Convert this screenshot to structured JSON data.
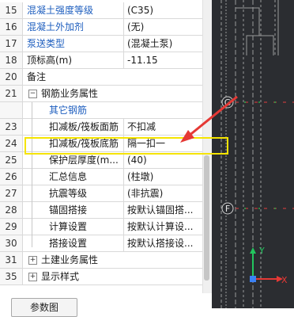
{
  "properties": {
    "rows": [
      {
        "num": "15",
        "name": "混凝土强度等级",
        "value": "(C35)",
        "blue": true
      },
      {
        "num": "16",
        "name": "混凝土外加剂",
        "value": "(无)",
        "blue": true
      },
      {
        "num": "17",
        "name": "泵送类型",
        "value": "(混凝土泵)",
        "blue": true
      },
      {
        "num": "18",
        "name": "顶标高(m)",
        "value": "-11.15",
        "blue": false
      },
      {
        "num": "20",
        "name": "备注",
        "value": "",
        "blue": false
      },
      {
        "num": "21",
        "name": "钢筋业务属性",
        "value": "",
        "blue": false,
        "toggle": "−"
      },
      {
        "num": "",
        "name": "其它钢筋",
        "value": "",
        "blue": true
      },
      {
        "num": "23",
        "name": "扣减板/筏板面筋",
        "value": "不扣减",
        "blue": false
      },
      {
        "num": "24",
        "name": "扣减板/筏板底筋",
        "value": "隔一扣一",
        "blue": false
      },
      {
        "num": "25",
        "name": "保护层厚度(m...",
        "value": "(40)",
        "blue": false
      },
      {
        "num": "26",
        "name": "汇总信息",
        "value": "(柱墩)",
        "blue": false
      },
      {
        "num": "27",
        "name": "抗震等级",
        "value": "(非抗震)",
        "blue": false
      },
      {
        "num": "28",
        "name": "锚固搭接",
        "value": "按默认锚固搭...",
        "blue": false
      },
      {
        "num": "29",
        "name": "计算设置",
        "value": "按默认计算设...",
        "blue": false
      },
      {
        "num": "30",
        "name": "搭接设置",
        "value": "按默认搭接设...",
        "blue": false
      },
      {
        "num": "31",
        "name": "土建业务属性",
        "value": "",
        "blue": false,
        "toggle": "+"
      },
      {
        "num": "35",
        "name": "显示样式",
        "value": "",
        "blue": false,
        "toggle": "+"
      }
    ]
  },
  "param_button_label": "参数图",
  "cad": {
    "axis_labels": [
      "G",
      "F"
    ],
    "ucs_x": "X",
    "ucs_y": "Y"
  },
  "colors": {
    "highlight": "#f5e400",
    "arrow": "#e53935",
    "link_text": "#1f5fbf",
    "canvas": "#2b2d31"
  }
}
